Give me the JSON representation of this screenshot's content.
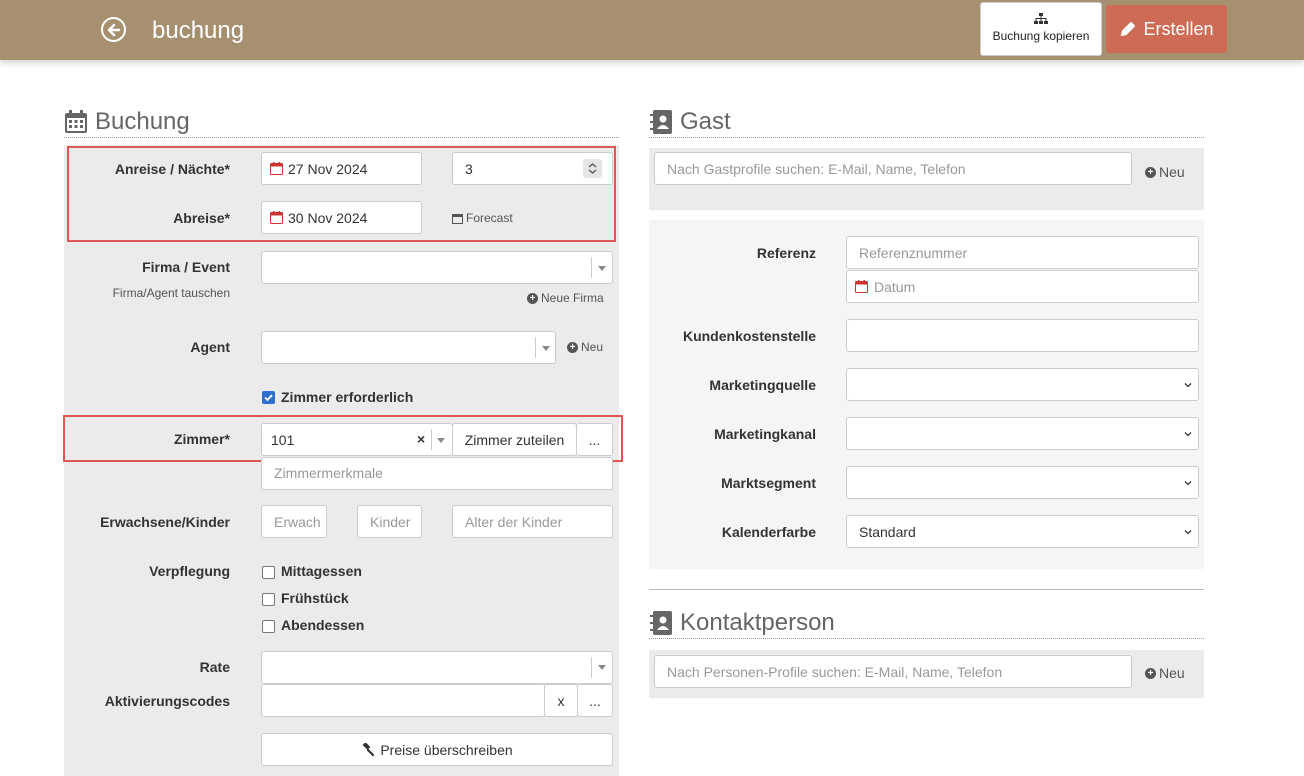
{
  "header": {
    "title": "buchung",
    "copy_label": "Buchung kopieren",
    "create_label": "Erstellen"
  },
  "buchung": {
    "section_title": "Buchung",
    "arrival_label": "Anreise / Nächte*",
    "arrival_value": "27 Nov 2024",
    "nights_value": "3",
    "departure_label": "Abreise*",
    "departure_value": "30 Nov 2024",
    "forecast_label": "Forecast",
    "company_label": "Firma / Event",
    "company_sub": "Firma/Agent tauschen",
    "new_company_label": "Neue Firma",
    "agent_label": "Agent",
    "agent_new_label": "Neu",
    "room_required_label": "Zimmer erforderlich",
    "room_label": "Zimmer*",
    "room_value": "101",
    "room_clear": "×",
    "assign_room_label": "Zimmer zuteilen",
    "more_label": "...",
    "room_features_placeholder": "Zimmermerkmale",
    "adults_children_label": "Erwachsene/Kinder",
    "adults_placeholder": "Erwach",
    "children_placeholder": "Kinder",
    "children_age_placeholder": "Alter der Kinder",
    "board_label": "Verpflegung",
    "board_lunch": "Mittagessen",
    "board_breakfast": "Frühstück",
    "board_dinner": "Abendessen",
    "rate_label": "Rate",
    "activation_label": "Aktivierungscodes",
    "activation_clear": "x",
    "activation_more": "...",
    "override_prices_label": "Preise überschreiben"
  },
  "gast": {
    "section_title": "Gast",
    "search_placeholder": "Nach Gastprofile suchen: E-Mail, Name, Telefon",
    "new_label": "Neu",
    "reference_label": "Referenz",
    "reference_placeholder": "Referenznummer",
    "date_placeholder": "Datum",
    "cost_center_label": "Kundenkostenstelle",
    "marketing_source_label": "Marketingquelle",
    "marketing_channel_label": "Marketingkanal",
    "market_segment_label": "Marktsegment",
    "calendar_color_label": "Kalenderfarbe",
    "calendar_color_value": "Standard"
  },
  "kontakt": {
    "section_title": "Kontaktperson",
    "search_placeholder": "Nach Personen-Profile suchen: E-Mail, Name, Telefon",
    "new_label": "Neu"
  },
  "colors": {
    "header_bg": "#a69070",
    "create_bg": "#cd6b55",
    "highlight_border": "#e05555",
    "checkbox_on": "#2d6fd1"
  }
}
